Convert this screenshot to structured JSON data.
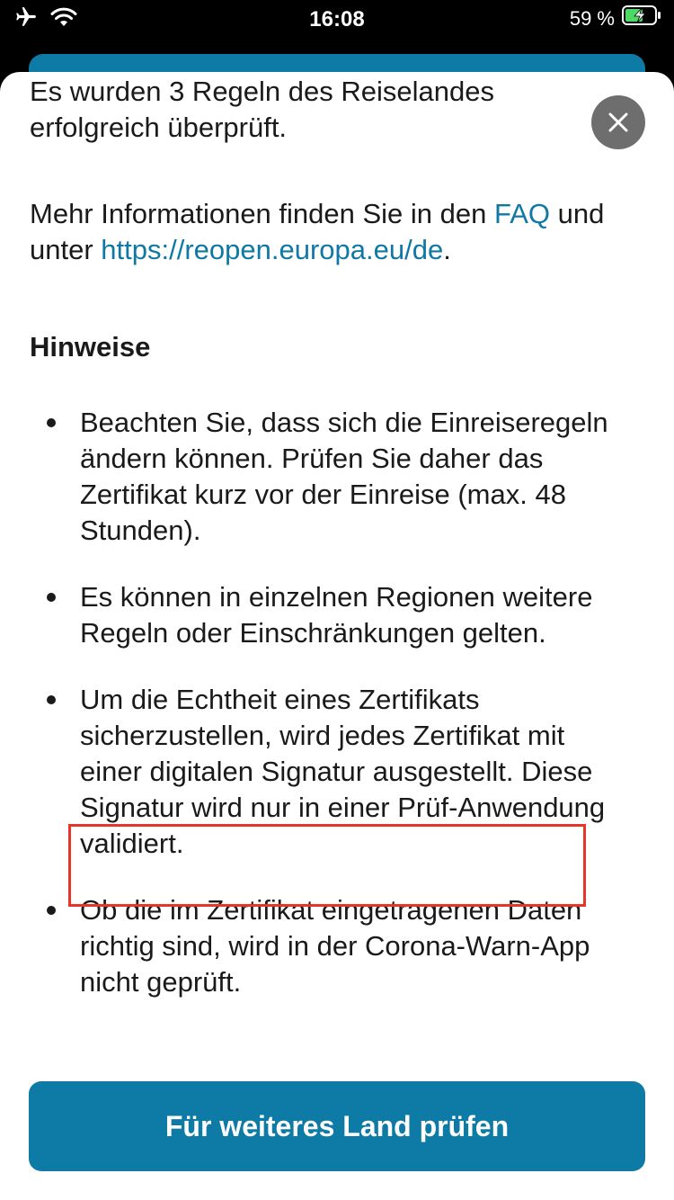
{
  "status_bar": {
    "time": "16:08",
    "battery_percent": "59 %",
    "icons": [
      "airplane-icon",
      "wifi-icon",
      "battery-charging-icon"
    ]
  },
  "sheet": {
    "intro": "Es wurden 3 Regeln des Reiselandes erfolgreich überprüft.",
    "more_prefix": "Mehr Informationen finden Sie in den ",
    "faq_link": "FAQ",
    "more_middle": " und unter ",
    "url_link": "https://reopen.europa.eu/de",
    "more_suffix": ".",
    "section_title": "Hinweise",
    "bullets": [
      "Beachten Sie, dass sich die Einreiseregeln ändern können. Prüfen Sie daher das Zertifikat kurz vor der Einreise (max. 48 Stunden).",
      "Es können in einzelnen Regionen weitere Regeln oder Einschränkungen gelten.",
      "Um die Echtheit eines Zertifikats sicherzustellen, wird jedes Zertifikat mit einer digitalen Signatur ausgestellt. Diese Signatur wird nur in einer Prüf-Anwendung validiert.",
      "Ob die im Zertifikat eingetragenen Daten richtig sind, wird in der Corona-Warn-App nicht geprüft."
    ],
    "action_button": "Für weiteres Land prüfen"
  },
  "colors": {
    "accent": "#0e7aa6",
    "link": "#0f78a5",
    "highlight": "#e8352a"
  }
}
